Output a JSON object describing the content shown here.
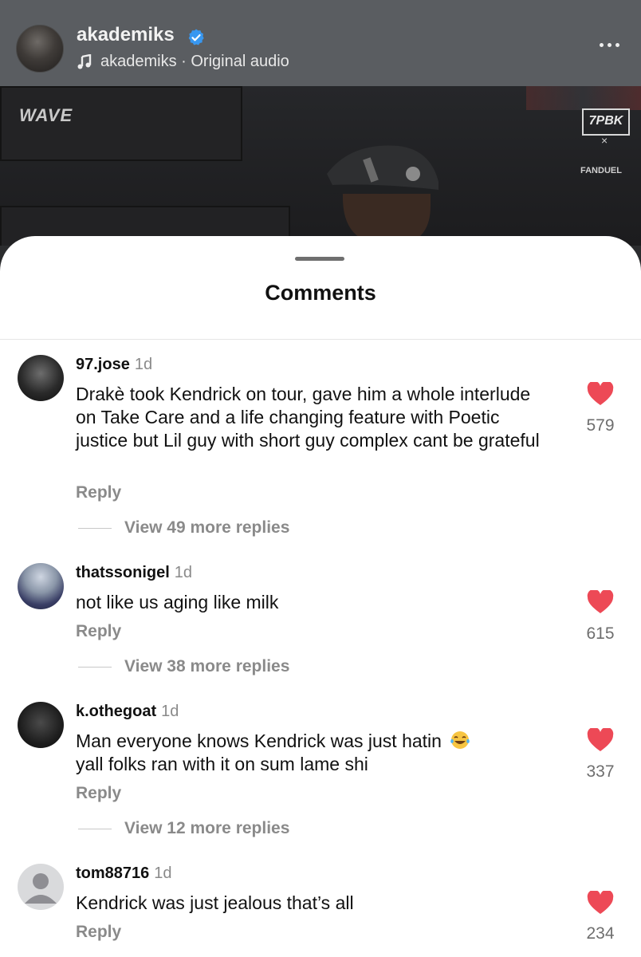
{
  "header": {
    "username": "akademiks",
    "audio": "akademiks · Original audio"
  },
  "video": {
    "logo_left": "WAVE",
    "logo_right": "7PBK",
    "logo_x": "×",
    "sponsor": "FANDUEL"
  },
  "sheet": {
    "title": "Comments"
  },
  "comments": [
    {
      "user": "97.jose",
      "time": "1d",
      "text": "Drakè took Kendrick on tour, gave him a whole interlude on Take Care and a life changing feature with Poetic justice but Lil guy with short guy complex cant be grateful",
      "reply": "Reply",
      "more": "View 49 more replies",
      "likes": "579"
    },
    {
      "user": "thatssonigel",
      "time": "1d",
      "text": "not like us aging like milk",
      "reply": "Reply",
      "more": "View 38 more replies",
      "likes": "615"
    },
    {
      "user": "k.othegoat",
      "time": "1d",
      "text": "Man everyone knows Kendrick was just hatin",
      "text2": "yall folks ran with it on sum lame shi",
      "emoji": "tears-of-joy-emoji",
      "reply": "Reply",
      "more": "View 12 more replies",
      "likes": "337"
    },
    {
      "user": "tom88716",
      "time": "1d",
      "text": "Kendrick was just jealous that’s all",
      "reply": "Reply",
      "likes": "234"
    }
  ],
  "colors": {
    "heart": "#ed4956",
    "verified": "#3897f0",
    "header_bg": "#5a5d61",
    "muted_text": "#8a8a8a"
  }
}
